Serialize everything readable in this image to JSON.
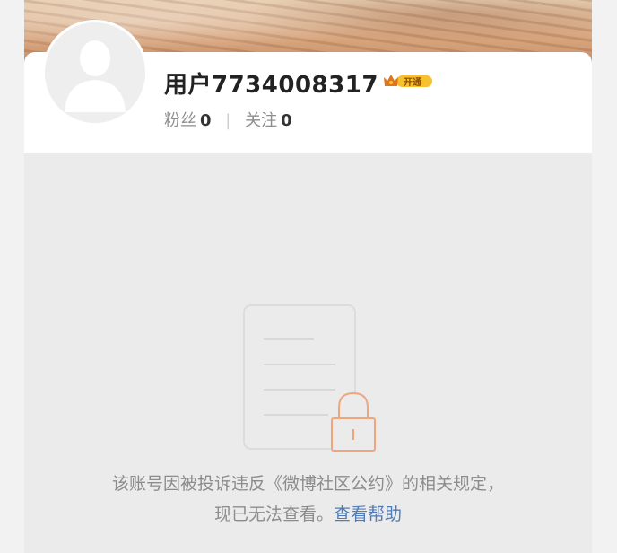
{
  "profile": {
    "username": "用户7734008317",
    "vip_badge_text": "开通",
    "fans_label": "粉丝",
    "fans_count": "0",
    "follow_label": "关注",
    "follow_count": "0",
    "separator": "|"
  },
  "notice": {
    "line1": "该账号因被投诉违反《微博社区公约》的相关规定，",
    "line2_prefix": "现已无法查看。",
    "help_link": "查看帮助"
  },
  "colors": {
    "link": "#4f7db8",
    "lock_orange": "#f0a67a",
    "vip_gold": "#f7c12e",
    "vip_crown": "#e2741d"
  },
  "icons": {
    "avatar": "default-avatar-silhouette",
    "vip": "crown-icon",
    "illustration": "locked-document-icon"
  }
}
